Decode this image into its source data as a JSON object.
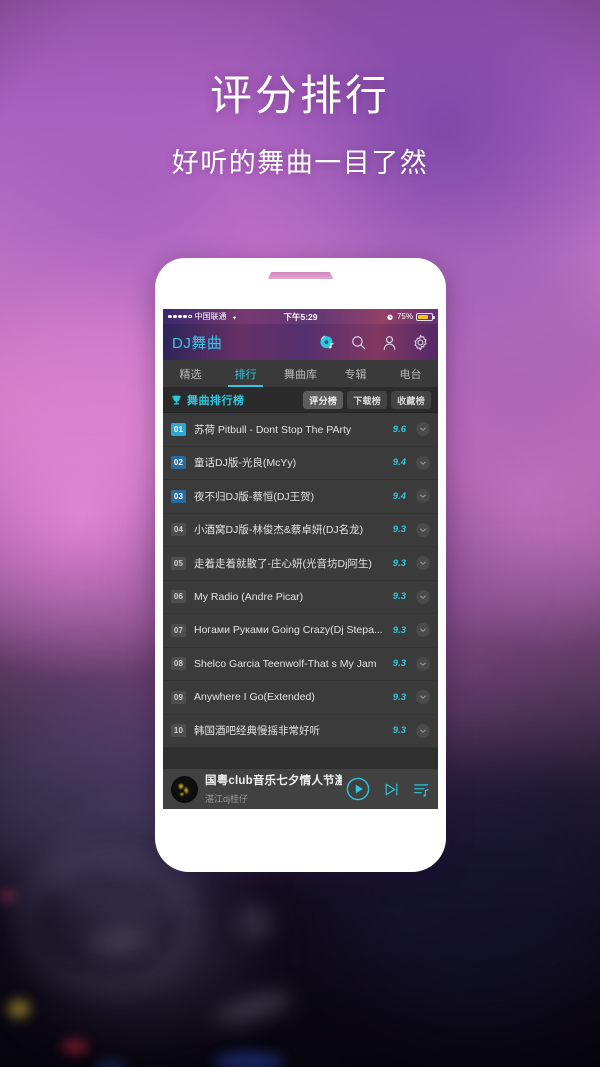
{
  "hero": {
    "title": "评分排行",
    "subtitle": "好听的舞曲一目了然"
  },
  "colors": {
    "accent": "#2fc6e0",
    "brand_text": "#36c8e6",
    "rank_top1_bg": "#2aa9d4",
    "rank_top_bg": "#2a6a9c",
    "battery": "#f0c419",
    "list_bg": "#3b3b3b"
  },
  "statusbar": {
    "carrier": "中国联通",
    "wifi_icon": "wifi-icon",
    "time": "下午5:29",
    "alarm_icon": "alarm-clock-icon",
    "battery_percent": "75%",
    "battery_level": 75
  },
  "appbar": {
    "brand": "DJ舞曲",
    "icons": [
      {
        "name": "music-disc-icon",
        "active": true
      },
      {
        "name": "search-icon",
        "active": false
      },
      {
        "name": "user-icon",
        "active": false
      },
      {
        "name": "gear-icon",
        "active": false
      }
    ]
  },
  "tabs": [
    {
      "label": "精选",
      "active": false
    },
    {
      "label": "排行",
      "active": true
    },
    {
      "label": "舞曲库",
      "active": false
    },
    {
      "label": "专辑",
      "active": false
    },
    {
      "label": "电台",
      "active": false
    }
  ],
  "section": {
    "icon": "trophy-icon",
    "title": "舞曲排行榜",
    "pills": [
      {
        "label": "评分榜",
        "active": true
      },
      {
        "label": "下载榜",
        "active": false
      },
      {
        "label": "收藏榜",
        "active": false
      }
    ]
  },
  "list": {
    "rows": [
      {
        "rank": "01",
        "title": "苏荷 Pitbull - Dont Stop The PArty",
        "score": "9.6",
        "style": "top1"
      },
      {
        "rank": "02",
        "title": "童话DJ版-光良(McYy)",
        "score": "9.4",
        "style": "top"
      },
      {
        "rank": "03",
        "title": "夜不归DJ版-蔡恒(DJ王贺)",
        "score": "9.4",
        "style": "top"
      },
      {
        "rank": "04",
        "title": "小酒窝DJ版-林俊杰&蔡卓妍(DJ名龙)",
        "score": "9.3",
        "style": "plain"
      },
      {
        "rank": "05",
        "title": "走着走着就散了-庄心妍(光音坊Dj阿生)",
        "score": "9.3",
        "style": "plain"
      },
      {
        "rank": "06",
        "title": "My Radio (Andre Picar)",
        "score": "9.3",
        "style": "plain"
      },
      {
        "rank": "07",
        "title": "Ногами Руками Going Crazy(Dj Stepa...",
        "score": "9.3",
        "style": "plain"
      },
      {
        "rank": "08",
        "title": "Shelco Garcia Teenwolf-That s My Jam",
        "score": "9.3",
        "style": "plain"
      },
      {
        "rank": "09",
        "title": "Anywhere I Go(Extended)",
        "score": "9.3",
        "style": "plain"
      },
      {
        "rank": "10",
        "title": "韩国酒吧经典慢摇非常好听",
        "score": "9.3",
        "style": "plain"
      }
    ]
  },
  "player": {
    "artwork": "album-art",
    "track_title": "国粤club音乐七夕情人节激",
    "track_artist": "湛江dj桂仔",
    "controls": [
      {
        "name": "play-button"
      },
      {
        "name": "next-track-button"
      },
      {
        "name": "playlist-button"
      }
    ]
  }
}
